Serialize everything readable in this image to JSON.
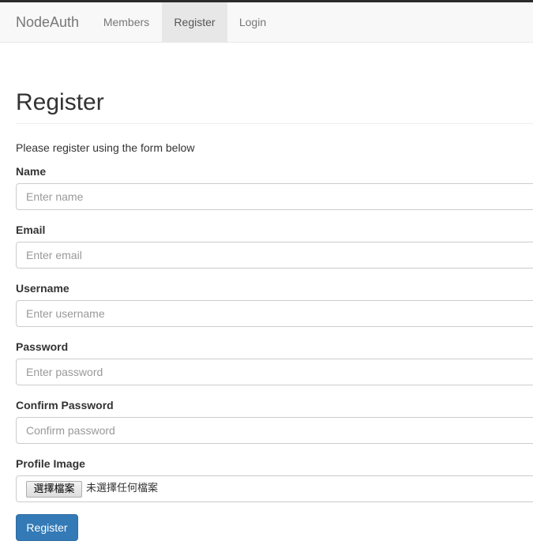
{
  "navbar": {
    "brand": "NodeAuth",
    "links": [
      {
        "label": "Members",
        "active": false
      },
      {
        "label": "Register",
        "active": true
      },
      {
        "label": "Login",
        "active": false
      }
    ]
  },
  "page": {
    "title": "Register",
    "intro": "Please register using the form below"
  },
  "form": {
    "name": {
      "label": "Name",
      "placeholder": "Enter name",
      "value": ""
    },
    "email": {
      "label": "Email",
      "placeholder": "Enter email",
      "value": ""
    },
    "username": {
      "label": "Username",
      "placeholder": "Enter username",
      "value": ""
    },
    "password": {
      "label": "Password",
      "placeholder": "Enter password",
      "value": ""
    },
    "confirm_password": {
      "label": "Confirm Password",
      "placeholder": "Confirm password",
      "value": ""
    },
    "profile_image": {
      "label": "Profile Image",
      "button_label": "選擇檔案",
      "status": "未選擇任何檔案"
    },
    "submit_label": "Register"
  },
  "colors": {
    "primary": "#337ab7",
    "navbar_bg": "#f8f8f8",
    "nav_active_bg": "#e7e7e7"
  }
}
